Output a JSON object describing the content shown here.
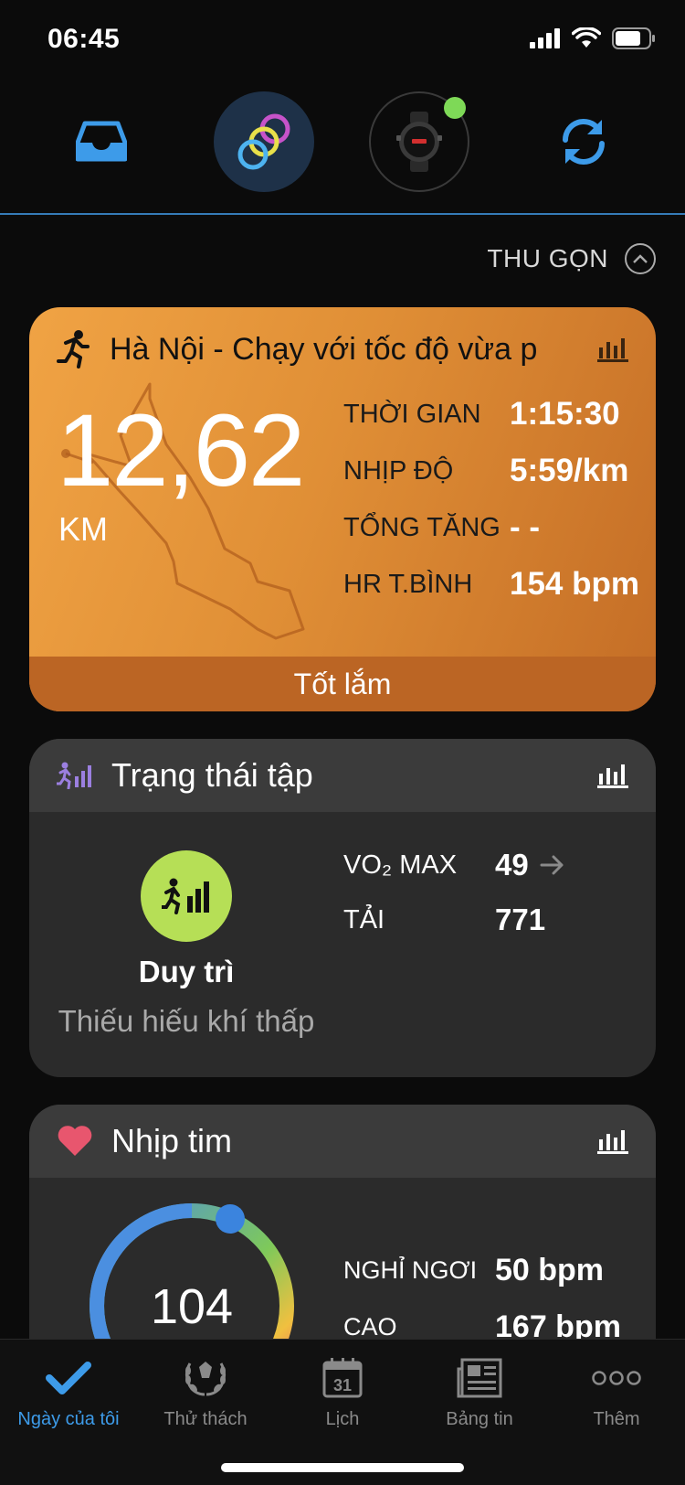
{
  "status_bar": {
    "time": "06:45"
  },
  "top_nav": {
    "items": [
      {
        "name": "inbox-icon"
      },
      {
        "name": "rings-icon"
      },
      {
        "name": "watch-icon"
      },
      {
        "name": "sync-icon"
      }
    ],
    "colors": {
      "accent": "#3d9be9",
      "device_connected": "#7ed957"
    }
  },
  "collapse": {
    "label": "THU GỌN"
  },
  "activity": {
    "title": "Hà Nội - Chạy với tốc độ vừa p",
    "distance": "12,62",
    "distance_unit": "KM",
    "stats": [
      {
        "label": "THỜI GIAN",
        "value": "1:15:30"
      },
      {
        "label": "NHỊP ĐỘ",
        "value": "5:59/km"
      },
      {
        "label": "TỔNG TĂNG",
        "value": "- -"
      },
      {
        "label": "HR T.BÌNH",
        "value": "154 bpm"
      }
    ],
    "footer": "Tốt lắm"
  },
  "training_status": {
    "title": "Trạng thái tập",
    "status": "Duy trì",
    "substatus": "Thiếu hiếu khí thấp",
    "stats": [
      {
        "label": "VO₂ MAX",
        "value": "49"
      },
      {
        "label": "TẢI",
        "value": "771"
      }
    ]
  },
  "heart_rate": {
    "title": "Nhịp tim",
    "current": "104",
    "stats": [
      {
        "label": "NGHỈ NGƠI",
        "value": "50 bpm"
      },
      {
        "label": "CAO",
        "value": "167 bpm"
      }
    ]
  },
  "tab_bar": {
    "tabs": [
      {
        "label": "Ngày của tôi",
        "active": true
      },
      {
        "label": "Thử thách"
      },
      {
        "label": "Lịch",
        "icon_text": "31"
      },
      {
        "label": "Bảng tin"
      },
      {
        "label": "Thêm"
      }
    ]
  }
}
